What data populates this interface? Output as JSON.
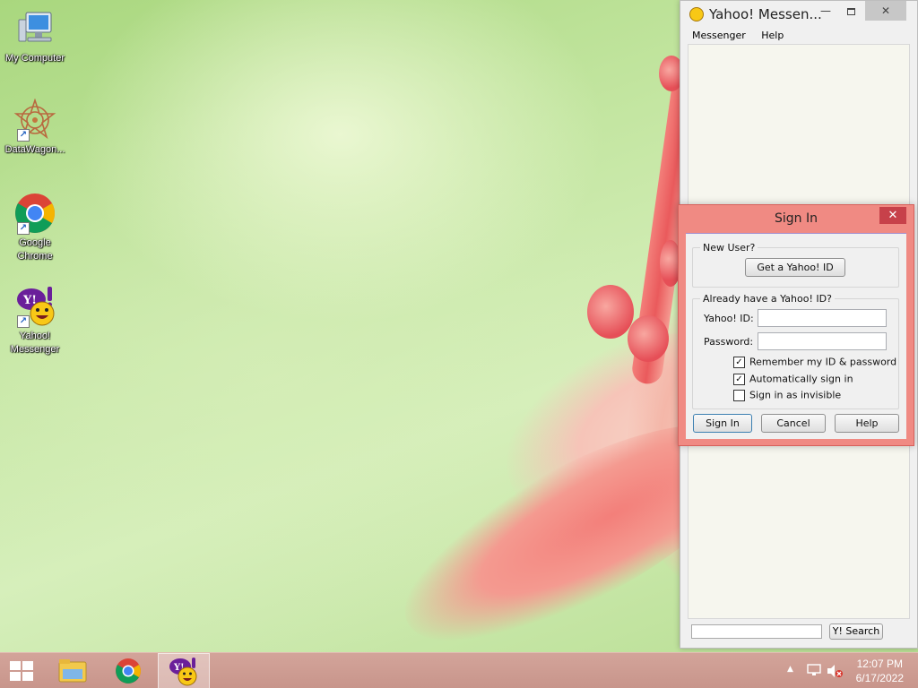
{
  "desktop": {
    "icons": [
      {
        "label": "My Computer",
        "icon": "computer-icon"
      },
      {
        "label": "DataWagon...",
        "icon": "datawagon-icon"
      },
      {
        "label": "Google Chrome",
        "icon": "chrome-icon"
      },
      {
        "label": "Yahoo! Messenger",
        "icon": "yahoo-messenger-icon"
      }
    ]
  },
  "main_window": {
    "title": "Yahoo! Messen...",
    "menu": [
      "Messenger",
      "Help"
    ],
    "search_button": "Y! Search",
    "search_value": ""
  },
  "signin_dialog": {
    "title": "Sign In",
    "close_glyph": "✕",
    "new_user": {
      "legend": "New User?",
      "get_id_button": "Get a Yahoo! ID"
    },
    "have_id": {
      "legend": "Already have a Yahoo! ID?",
      "yahoo_id_label": "Yahoo! ID:",
      "yahoo_id_value": "",
      "password_label": "Password:",
      "password_value": "",
      "checkboxes": [
        {
          "label": "Remember my ID & password",
          "checked": true
        },
        {
          "label": "Automatically sign in",
          "checked": true
        },
        {
          "label": "Sign in as invisible",
          "checked": false
        }
      ]
    },
    "buttons": {
      "sign_in": "Sign In",
      "cancel": "Cancel",
      "help": "Help"
    }
  },
  "taskbar": {
    "pinned": [
      "file-explorer-icon",
      "chrome-icon",
      "yahoo-messenger-icon"
    ],
    "active_app": "Yahoo! Messenger",
    "clock": {
      "time": "12:07 PM",
      "date": "6/17/2022"
    }
  },
  "colors": {
    "dialog_accent": "#f08a83",
    "taskbar": "#c8958b",
    "yahoo_purple": "#6a1f9a",
    "yahoo_yellow": "#f8c816"
  }
}
